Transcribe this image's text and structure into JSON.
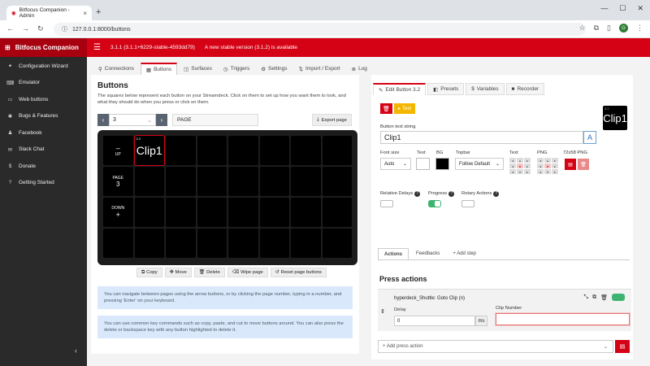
{
  "browser": {
    "tab_title": "Bitfocus Companion - Admin",
    "url": "127.0.0.1:8000/buttons"
  },
  "header": {
    "brand": "Bitfocus Companion",
    "version_text": "3.1.1 (3.1.1+6229-stable-4593dd79)",
    "update_text": "A new stable version (3.1.2) is available",
    "brand_color": "#d50215"
  },
  "sidebar": {
    "items": [
      {
        "label": "Configuration Wizard",
        "icon": "magic-icon"
      },
      {
        "label": "Emulator",
        "icon": "keyboard-icon"
      },
      {
        "label": "Web buttons",
        "icon": "monitor-icon"
      },
      {
        "label": "Bugs & Features",
        "icon": "bug-icon"
      },
      {
        "label": "Facebook",
        "icon": "users-icon"
      },
      {
        "label": "Slack Chat",
        "icon": "chat-icon"
      },
      {
        "label": "Donate",
        "icon": "dollar-icon"
      },
      {
        "label": "Getting Started",
        "icon": "help-icon"
      }
    ]
  },
  "main_tabs": [
    "Connections",
    "Buttons",
    "Surfaces",
    "Triggers",
    "Settings",
    "Import / Export",
    "Log"
  ],
  "buttons_panel": {
    "title": "Buttons",
    "description": "The squares below represent each button on your Streamdeck. Click on them to set up how you want them to look, and what they should do when you press or click on them.",
    "page_number": "3",
    "page_name": "PAGE",
    "export_label": "Export page",
    "grid_labels": {
      "up": "UP",
      "page": "PAGE",
      "page_num": "3",
      "down": "DOWN",
      "selected_tag": "3.2",
      "selected_text": "Clip1"
    },
    "actions": [
      "Copy",
      "Move",
      "Delete",
      "Wipe page",
      "Reset page buttons"
    ],
    "info1": "You can navigate between pages using the arrow buttons, or by clicking the page number, typing in a number, and pressing 'Enter' on your keyboard.",
    "info2": "You can use common key commands such as copy, paste, and cut to move buttons around. You can also press the delete or backspace key with any button highlighted to delete it."
  },
  "edit_panel": {
    "tabs": [
      "Edit Button 3.2",
      "Presets",
      "Variables",
      "Recorder"
    ],
    "test_label": "Test",
    "preview_tag": "3.2",
    "preview_text": "Clip1",
    "text_string_label": "Button text string",
    "text_string_value": "Clip1",
    "font_size_label": "Font size",
    "font_size_value": "Auto",
    "text_label": "Text",
    "bg_label": "BG",
    "topbar_label": "Topbar",
    "topbar_value": "Follow Default",
    "text_align_label": "Text",
    "png_label": "PNG",
    "png_size_label": "72x58 PNG",
    "relative_delays_label": "Relative Delays",
    "progress_label": "Progress",
    "rotary_label": "Rotary Actions",
    "subtabs": [
      "Actions",
      "Feedbacks",
      "+ Add step"
    ],
    "press_actions_title": "Press actions",
    "action_name": "hyperdeck_Shuttle: Goto Clip (n)",
    "delay_label": "Delay",
    "delay_value": "0",
    "delay_unit": "ms",
    "clip_number_label": "Clip Number",
    "add_action_placeholder": "+ Add press action"
  }
}
